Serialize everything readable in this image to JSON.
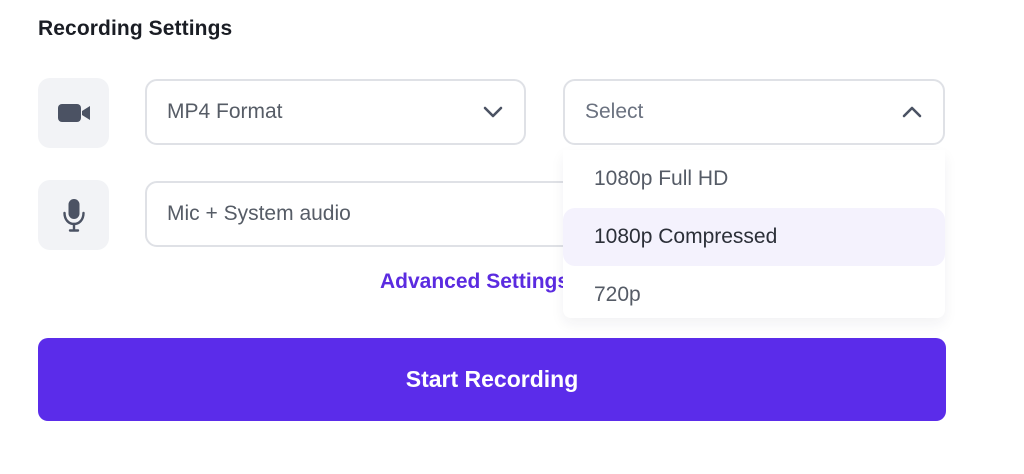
{
  "section": {
    "title": "Recording Settings"
  },
  "video": {
    "icon": "video-camera-icon",
    "format_value": "MP4 Format",
    "quality_placeholder": "Select",
    "quality_open": true,
    "quality_options": [
      "1080p Full HD",
      "1080p Compressed",
      "720p"
    ],
    "quality_highlighted": "1080p Compressed"
  },
  "audio": {
    "icon": "microphone-icon",
    "source_value": "Mic + System audio"
  },
  "links": {
    "advanced_settings": "Advanced Settings"
  },
  "actions": {
    "start_label": "Start Recording"
  },
  "colors": {
    "accent": "#5b2cea",
    "link": "#5b2be0",
    "highlight": "#f4f2fd",
    "tile": "#f2f3f6",
    "border": "#dfe1e6"
  }
}
